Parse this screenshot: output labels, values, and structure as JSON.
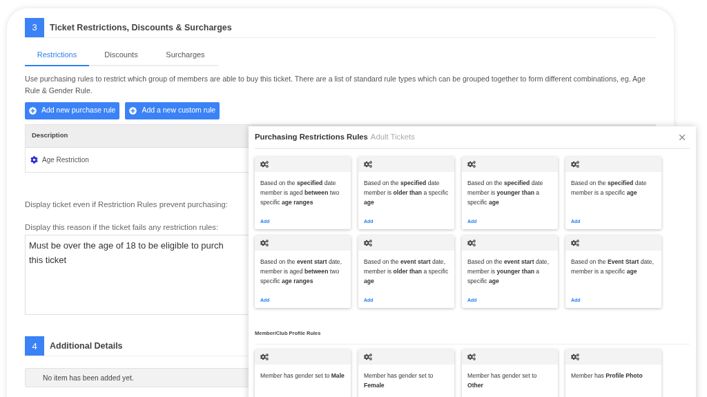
{
  "section3": {
    "number": "3",
    "title": "Ticket Restrictions, Discounts & Surcharges",
    "tabs": [
      {
        "label": "Restrictions",
        "selected": true
      },
      {
        "label": "Discounts",
        "selected": false
      },
      {
        "label": "Surcharges",
        "selected": false
      }
    ],
    "description": "Use purchasing rules to restrict which group of members are able to buy this ticket. There are a list of standard rule types which can be grouped together to form different combinations, eg. Age Rule & Gender Rule.",
    "buttons": [
      "Add new purchase rule",
      "Add a new custom rule"
    ],
    "table": {
      "columns": [
        "Description"
      ],
      "rows": [
        [
          "Age Restriction"
        ]
      ]
    },
    "display_even_label": "Display ticket even if Restriction Rules prevent purchasing:",
    "reason_label": "Display this reason if the ticket fails any restriction rules:",
    "reason_value": "Must be over the age of 18 to be eligible to purch\nthis ticket"
  },
  "section4": {
    "number": "4",
    "title": "Additional Details",
    "empty_message": "No item has been added yet."
  },
  "modal": {
    "title": "Purchasing Restrictions Rules",
    "subtitle": "Adult Tickets",
    "groups": [
      {
        "rules": [
          {
            "text": "Based on the **specified** date member is aged **between** two specific **age ranges**",
            "action": "Add"
          },
          {
            "text": "Based on the **specified** date member is **older than** a specific **age**",
            "action": "Add"
          },
          {
            "text": "Based on the **specified** date member is **younger than** a specific **age**",
            "action": "Add"
          },
          {
            "text": "Based on the **specified** date member is a specific **age**",
            "action": "Add"
          },
          {
            "text": "Based on the **event start** date, member is aged **between** two specific **age ranges**",
            "action": "Add"
          },
          {
            "text": "Based on the **event start** date, member is **older than** a specific **age**",
            "action": "Add"
          },
          {
            "text": "Based on the **event start** date, member is **younger than** a specific **age**",
            "action": "Add"
          },
          {
            "text": "Based on the **Event Start** date, member is a specific **age**",
            "action": "Add"
          }
        ]
      },
      {
        "heading": "Member/Club Profile Rules",
        "rules": [
          {
            "text": "Member has gender set to **Male**"
          },
          {
            "text": "Member has gender set to **Female**"
          },
          {
            "text": "Member has gender set to **Other**"
          },
          {
            "text": "Member has **Profile Photo**"
          }
        ]
      }
    ]
  }
}
